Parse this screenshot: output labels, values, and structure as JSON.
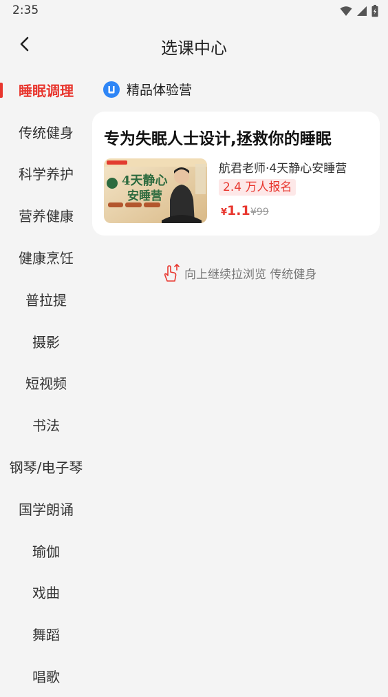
{
  "status_bar": {
    "time": "2:35"
  },
  "header": {
    "title": "选课中心"
  },
  "sidebar": {
    "items": [
      {
        "label": "睡眠调理",
        "active": true
      },
      {
        "label": "传统健身"
      },
      {
        "label": "科学养护"
      },
      {
        "label": "营养健康"
      },
      {
        "label": "健康烹饪"
      },
      {
        "label": "普拉提"
      },
      {
        "label": "摄影"
      },
      {
        "label": "短视频"
      },
      {
        "label": "书法"
      },
      {
        "label": "钢琴/电子琴"
      },
      {
        "label": "国学朗诵"
      },
      {
        "label": "瑜伽"
      },
      {
        "label": "戏曲"
      },
      {
        "label": "舞蹈"
      },
      {
        "label": "唱歌"
      }
    ]
  },
  "main": {
    "section_title": "精品体验营",
    "card": {
      "title": "专为失眠人士设计,拯救你的睡眠",
      "course_name": "航君老师·4天静心安睡营",
      "enroll_badge": "2.4 万人报名",
      "price_symbol": "¥",
      "price": "1.1",
      "original_price": "¥99",
      "thumbnail": {
        "banner_title": "4天静心",
        "banner_subtitle": "安睡营"
      }
    },
    "scroll_hint": "向上继续拉浏览 传统健身"
  },
  "colors": {
    "accent": "#e8362e",
    "background": "#f4f4f4",
    "card": "#ffffff"
  }
}
